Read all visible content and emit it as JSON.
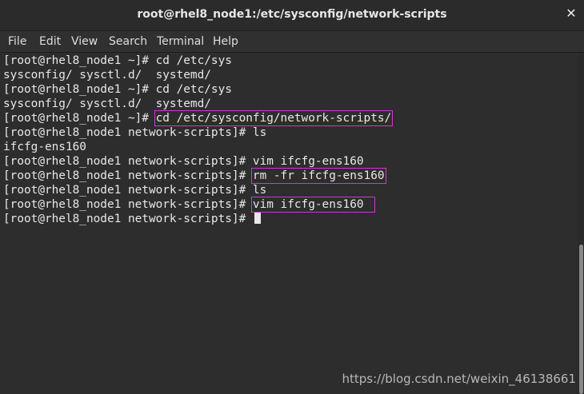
{
  "window": {
    "title": "root@rhel8_node1:/etc/sysconfig/network-scripts",
    "close_icon": "close-icon"
  },
  "menu": {
    "file": "File",
    "edit": "Edit",
    "view": "View",
    "search": "Search",
    "terminal": "Terminal",
    "help": "Help"
  },
  "terminal": {
    "prompt_home": "[root@rhel8_node1 ~]# ",
    "prompt_ns": "[root@rhel8_node1 network-scripts]# ",
    "l1_cmd": "cd /etc/sys",
    "l2": "sysconfig/ sysctl.d/  systemd/",
    "l3_cmd": "cd /etc/sys",
    "l4": "sysconfig/ sysctl.d/  systemd/",
    "l5_cmd": "cd /etc/sysconfig/network-scripts/",
    "l6_cmd": "ls",
    "l7": "ifcfg-ens160",
    "l8_cmd": "vim ifcfg-ens160",
    "l9_cmd": "rm -fr ifcfg-ens160",
    "l10_cmd": "ls",
    "l11_cmd": "vim ifcfg-ens160"
  },
  "watermark": "https://blog.csdn.net/weixin_46138661",
  "colors": {
    "background": "#2d2d2d",
    "text": "#e8e8e8",
    "highlight_box": "#d236d2"
  }
}
